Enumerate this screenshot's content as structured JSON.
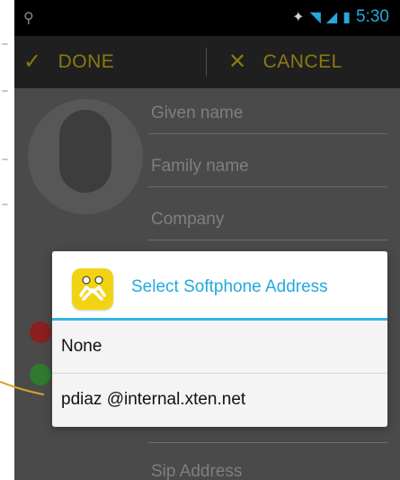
{
  "status_bar": {
    "time": "5:30",
    "left_icon": "usb-icon",
    "right_icons": [
      "mute-icon",
      "wifi-icon",
      "signal-icon",
      "battery-icon"
    ]
  },
  "action_bar": {
    "done_label": "DONE",
    "cancel_label": "CANCEL",
    "done_icon": "check-icon",
    "cancel_icon": "close-icon",
    "accent_color": "#8b7a11"
  },
  "form": {
    "fields": [
      {
        "label": "Given name"
      },
      {
        "label": "Family name"
      },
      {
        "label": "Company"
      }
    ],
    "bottom_field_label": "Sip Address"
  },
  "dialog": {
    "title": "Select Softphone Address",
    "app_icon": "softphone-app-icon",
    "options": [
      {
        "label": "None"
      },
      {
        "label": "pdiaz @internal.xten.net"
      }
    ],
    "title_color": "#22a9e0",
    "accent_color": "#33b5e5"
  }
}
